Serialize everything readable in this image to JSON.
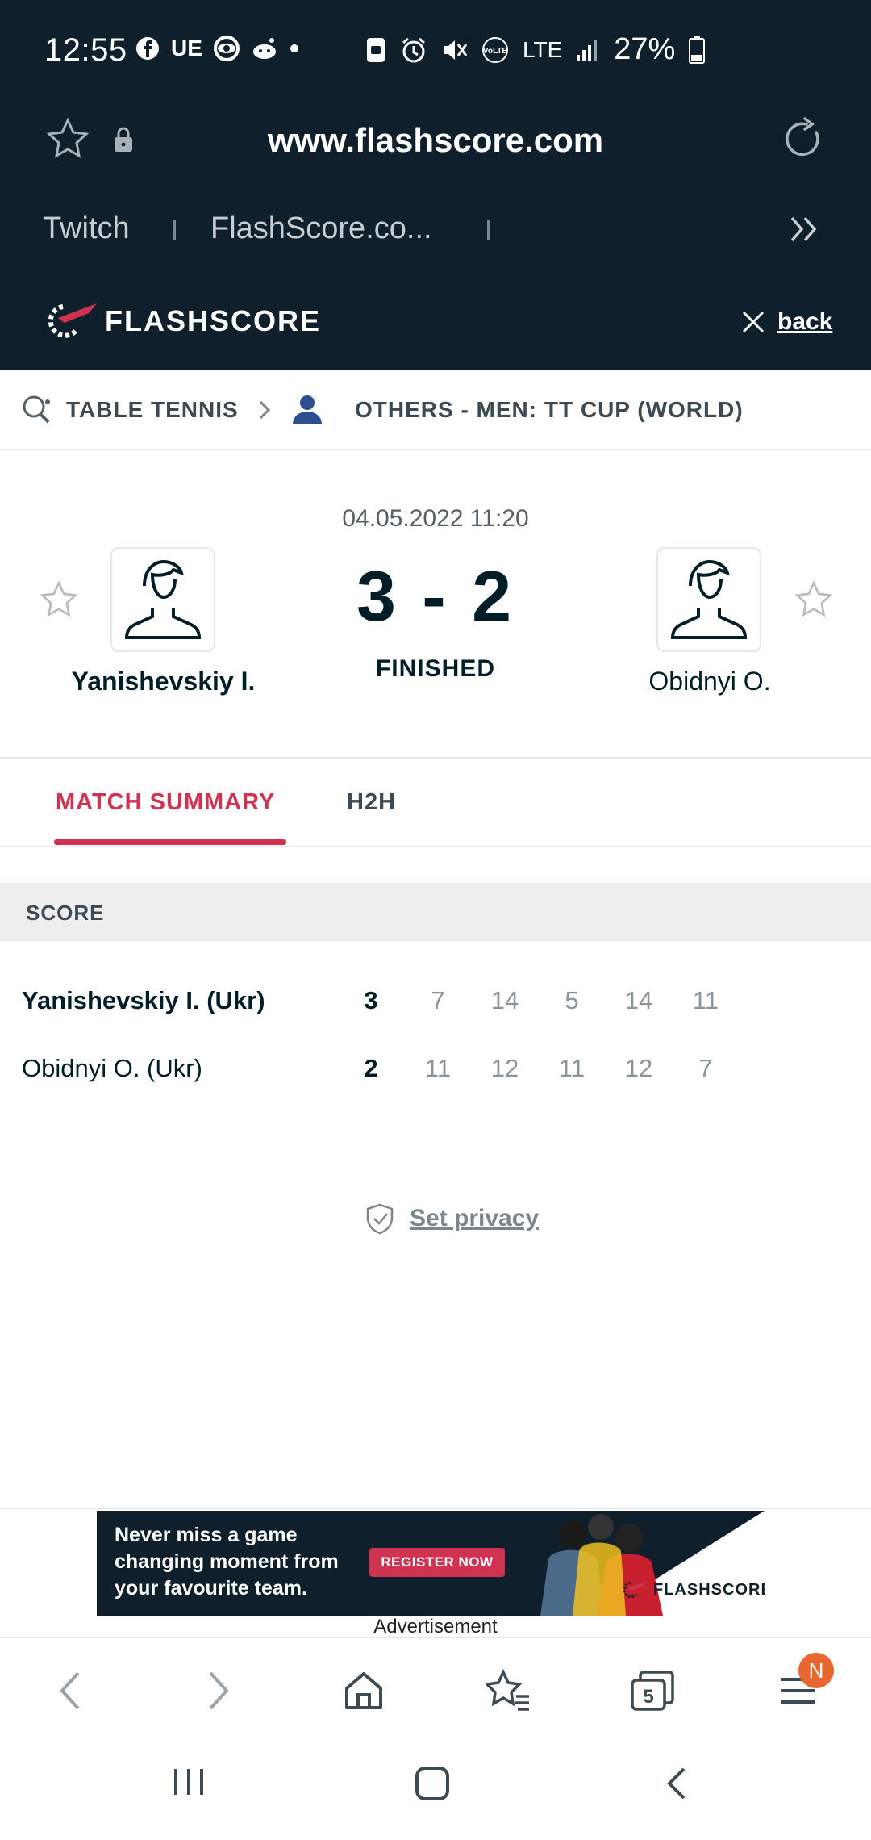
{
  "status_bar": {
    "time": "12:55",
    "left_icons": [
      "facebook-icon",
      "ue-label",
      "cbs-icon",
      "reddit-icon",
      "dot"
    ],
    "ue_label": "UE",
    "network_label": "LTE",
    "battery": "27%"
  },
  "browser": {
    "url": "www.flashscore.com",
    "bookmarks": [
      "Twitch",
      "FlashScore.co..."
    ]
  },
  "header": {
    "logo_text": "FLASHSCORE",
    "back_label": "back"
  },
  "breadcrumb": {
    "sport": "TABLE TENNIS",
    "competition": "OTHERS - MEN: TT CUP (WORLD)"
  },
  "match": {
    "datetime": "04.05.2022 11:20",
    "home_player": "Yanishevskiy I.",
    "away_player": "Obidnyi O.",
    "score": "3 - 2",
    "status": "FINISHED"
  },
  "tabs": {
    "summary": "MATCH SUMMARY",
    "h2h": "H2H"
  },
  "score_table": {
    "heading": "SCORE",
    "rows": [
      {
        "name": "Yanishevskiy I. (Ukr)",
        "total": "3",
        "sets": [
          "7",
          "14",
          "5",
          "14",
          "11"
        ]
      },
      {
        "name": "Obidnyi O. (Ukr)",
        "total": "2",
        "sets": [
          "11",
          "12",
          "11",
          "12",
          "7"
        ]
      }
    ]
  },
  "privacy": {
    "label": "Set privacy"
  },
  "ad": {
    "text": "Never miss a game changing moment from your favourite team.",
    "button": "REGISTER NOW",
    "logo": "FLASHSCORE",
    "caption": "Advertisement"
  },
  "bottom_nav": {
    "tab_count": "5",
    "badge": "N"
  },
  "colors": {
    "dark": "#0f1f2b",
    "accent": "#d0334f",
    "badge": "#e8672e"
  }
}
